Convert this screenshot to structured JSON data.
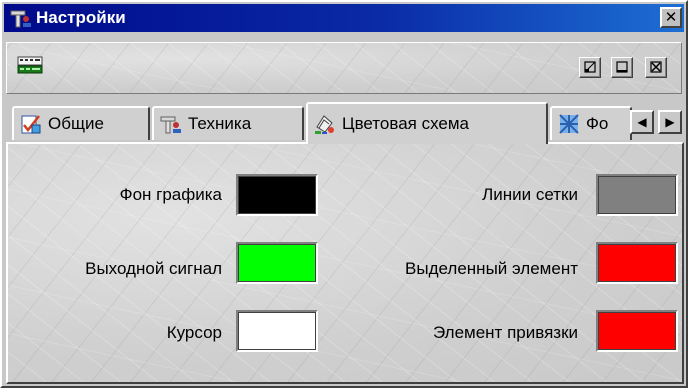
{
  "window": {
    "title": "Настройки",
    "close_glyph": "✕"
  },
  "toolbar": {
    "icon": "keyboard-icon",
    "buttons": [
      {
        "name": "restore-button",
        "icon": "restore-icon"
      },
      {
        "name": "minimize-button",
        "icon": "minimize-icon"
      },
      {
        "name": "close-button",
        "icon": "close-icon"
      }
    ]
  },
  "tabs": [
    {
      "label": "Общие",
      "icon": "general-settings-icon",
      "active": false
    },
    {
      "label": "Техника",
      "icon": "hardware-icon",
      "active": false
    },
    {
      "label": "Цветовая схема",
      "icon": "palette-icon",
      "active": true
    },
    {
      "label": "Фо",
      "icon": "font-icon",
      "active": false
    }
  ],
  "tab_scroll": {
    "left_glyph": "◀",
    "right_glyph": "▶"
  },
  "colors": {
    "left": [
      {
        "label": "Фон графика",
        "color": "#000000"
      },
      {
        "label": "Выходной сигнал",
        "color": "#00ff00"
      },
      {
        "label": "Курсор",
        "color": "#ffffff"
      }
    ],
    "right": [
      {
        "label": "Линии сетки",
        "color": "#808080"
      },
      {
        "label": "Выделенный элемент",
        "color": "#ff0000"
      },
      {
        "label": "Элемент привязки",
        "color": "#ff0000"
      }
    ]
  },
  "theme": {
    "titlebar_start": "#000a8a",
    "titlebar_end": "#1d6fd4"
  }
}
